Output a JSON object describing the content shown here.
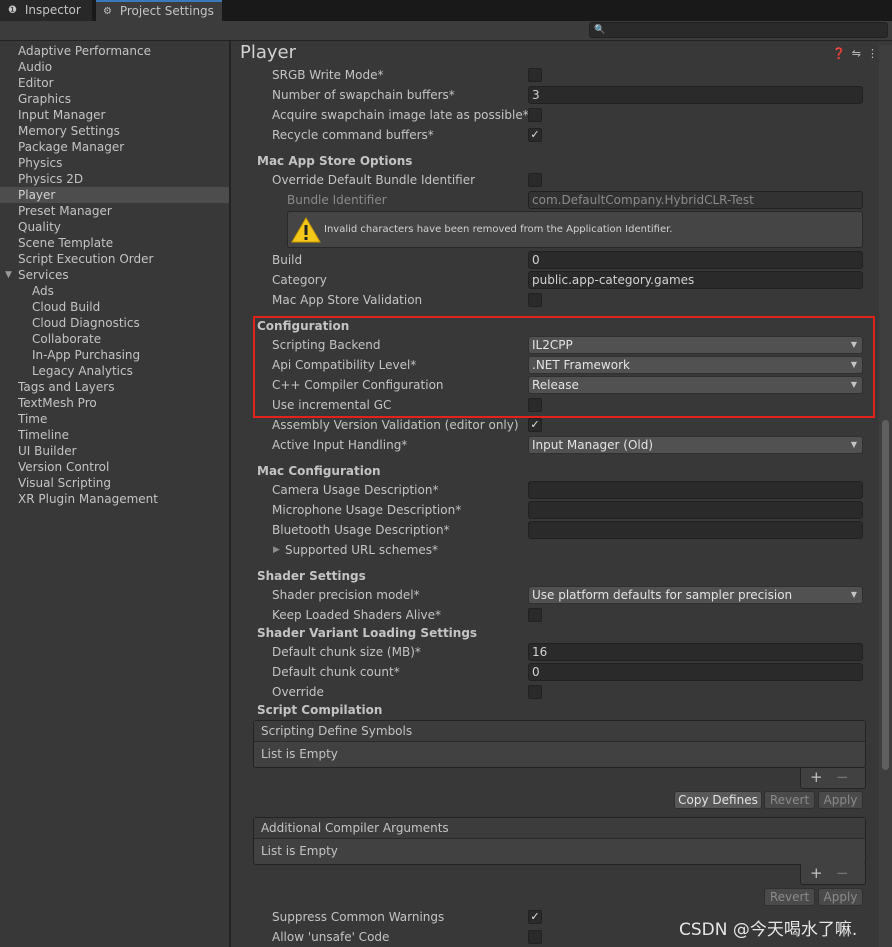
{
  "tabs": {
    "inspector": {
      "icon": "info-icon",
      "label": "Inspector"
    },
    "project_settings": {
      "icon": "gear-icon",
      "label": "Project Settings"
    }
  },
  "search": {
    "placeholder": ""
  },
  "sidebar": {
    "items": [
      {
        "label": "Adaptive Performance"
      },
      {
        "label": "Audio"
      },
      {
        "label": "Editor"
      },
      {
        "label": "Graphics"
      },
      {
        "label": "Input Manager"
      },
      {
        "label": "Memory Settings"
      },
      {
        "label": "Package Manager"
      },
      {
        "label": "Physics"
      },
      {
        "label": "Physics 2D"
      },
      {
        "label": "Player",
        "selected": true
      },
      {
        "label": "Preset Manager"
      },
      {
        "label": "Quality"
      },
      {
        "label": "Scene Template"
      },
      {
        "label": "Script Execution Order"
      },
      {
        "label": "Services",
        "expanded": true
      },
      {
        "label": "Ads",
        "child": true
      },
      {
        "label": "Cloud Build",
        "child": true
      },
      {
        "label": "Cloud Diagnostics",
        "child": true
      },
      {
        "label": "Collaborate",
        "child": true
      },
      {
        "label": "In-App Purchasing",
        "child": true
      },
      {
        "label": "Legacy Analytics",
        "child": true
      },
      {
        "label": "Tags and Layers"
      },
      {
        "label": "TextMesh Pro"
      },
      {
        "label": "Time"
      },
      {
        "label": "Timeline"
      },
      {
        "label": "UI Builder"
      },
      {
        "label": "Version Control"
      },
      {
        "label": "Visual Scripting"
      },
      {
        "label": "XR Plugin Management"
      }
    ]
  },
  "main": {
    "title": "Player",
    "header_icons": [
      "help-icon",
      "presets-icon",
      "menu-icon"
    ],
    "srgb": {
      "label": "SRGB Write Mode*",
      "checked": false
    },
    "swapchain": {
      "label": "Number of swapchain buffers*",
      "value": "3"
    },
    "acquire": {
      "label": "Acquire swapchain image late as possible*",
      "checked": false
    },
    "recycle": {
      "label": "Recycle command buffers*",
      "checked": true
    },
    "mac_app_store": {
      "title": "Mac App Store Options",
      "override_bundle": {
        "label": "Override Default Bundle Identifier",
        "checked": false
      },
      "bundle_id": {
        "label": "Bundle Identifier",
        "value": "com.DefaultCompany.HybridCLR-Test"
      },
      "warning": "Invalid characters have been removed from the Application Identifier.",
      "build": {
        "label": "Build",
        "value": "0"
      },
      "category": {
        "label": "Category",
        "value": "public.app-category.games"
      },
      "validation": {
        "label": "Mac App Store Validation",
        "checked": false
      }
    },
    "configuration": {
      "title": "Configuration",
      "scripting_backend": {
        "label": "Scripting Backend",
        "value": "IL2CPP"
      },
      "api_level": {
        "label": "Api Compatibility Level*",
        "value": ".NET Framework"
      },
      "cpp_config": {
        "label": "C++ Compiler Configuration",
        "value": "Release"
      },
      "incremental_gc": {
        "label": "Use incremental GC",
        "checked": false
      },
      "assembly_validation": {
        "label": "Assembly Version Validation (editor only)",
        "checked": true
      },
      "input_handling": {
        "label": "Active Input Handling*",
        "value": "Input Manager (Old)"
      }
    },
    "mac_configuration": {
      "title": "Mac Configuration",
      "camera": {
        "label": "Camera Usage Description*",
        "value": ""
      },
      "microphone": {
        "label": "Microphone Usage Description*",
        "value": ""
      },
      "bluetooth": {
        "label": "Bluetooth Usage Description*",
        "value": ""
      },
      "url_schemes": {
        "label": "Supported URL schemes*"
      }
    },
    "shader_settings": {
      "title": "Shader Settings",
      "precision": {
        "label": "Shader precision model*",
        "value": "Use platform defaults for sampler precision"
      },
      "keep_loaded": {
        "label": "Keep Loaded Shaders Alive*",
        "checked": false
      }
    },
    "shader_variant": {
      "title": "Shader Variant Loading Settings",
      "chunk_size": {
        "label": "Default chunk size (MB)*",
        "value": "16"
      },
      "chunk_count": {
        "label": "Default chunk count*",
        "value": "0"
      },
      "override": {
        "label": "Override",
        "checked": false
      }
    },
    "script_compilation": {
      "title": "Script Compilation",
      "define_symbols": {
        "header": "Scripting Define Symbols",
        "empty": "List is Empty"
      },
      "copy_defines": "Copy Defines",
      "revert": "Revert",
      "apply": "Apply",
      "compiler_args": {
        "header": "Additional Compiler Arguments",
        "empty": "List is Empty"
      },
      "plus": "+",
      "minus": "−"
    },
    "suppress_warnings": {
      "label": "Suppress Common Warnings",
      "checked": true
    },
    "allow_unsafe": {
      "label": "Allow 'unsafe' Code",
      "checked": false
    }
  },
  "watermark": "CSDN @今天喝水了嘛.",
  "colors": {
    "highlight_box": "#e3221c",
    "selected_tab_accent": "#3a79bb",
    "warning_icon": "#f4c81b"
  }
}
